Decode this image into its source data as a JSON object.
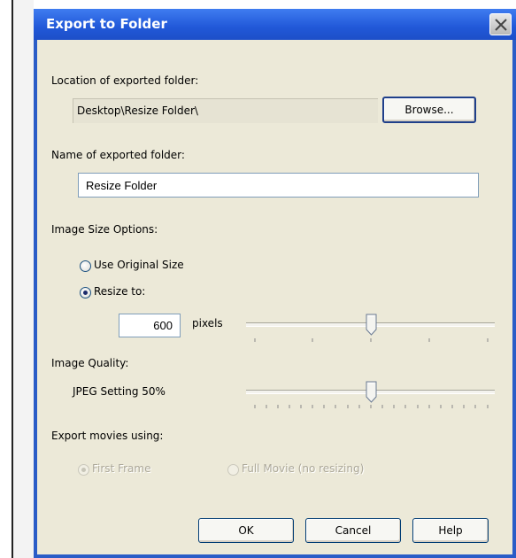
{
  "dialog": {
    "title": "Export to Folder",
    "location_label": "Location of exported folder:",
    "location_value": "Desktop\\Resize Folder\\",
    "browse_button": "Browse...",
    "name_label": "Name of exported folder:",
    "name_value": "Resize Folder",
    "image_size_label": "Image Size Options:",
    "use_original_label": "Use Original Size",
    "resize_to_label": "Resize to:",
    "resize_value": "600",
    "pixels_label": "pixels",
    "resize_slider_level": 0.5,
    "image_quality_label": "Image Quality:",
    "jpeg_setting_label": "JPEG Setting 50%",
    "quality_slider_level": 0.5,
    "export_movies_label": "Export movies using:",
    "first_frame_label": "First Frame",
    "full_movie_label": "Full Movie (no resizing)",
    "ok_button": "OK",
    "cancel_button": "Cancel",
    "help_button": "Help"
  },
  "colors": {
    "titlebar": "#2158d8",
    "client": "#ece9d8",
    "button_border": "#003c74"
  }
}
